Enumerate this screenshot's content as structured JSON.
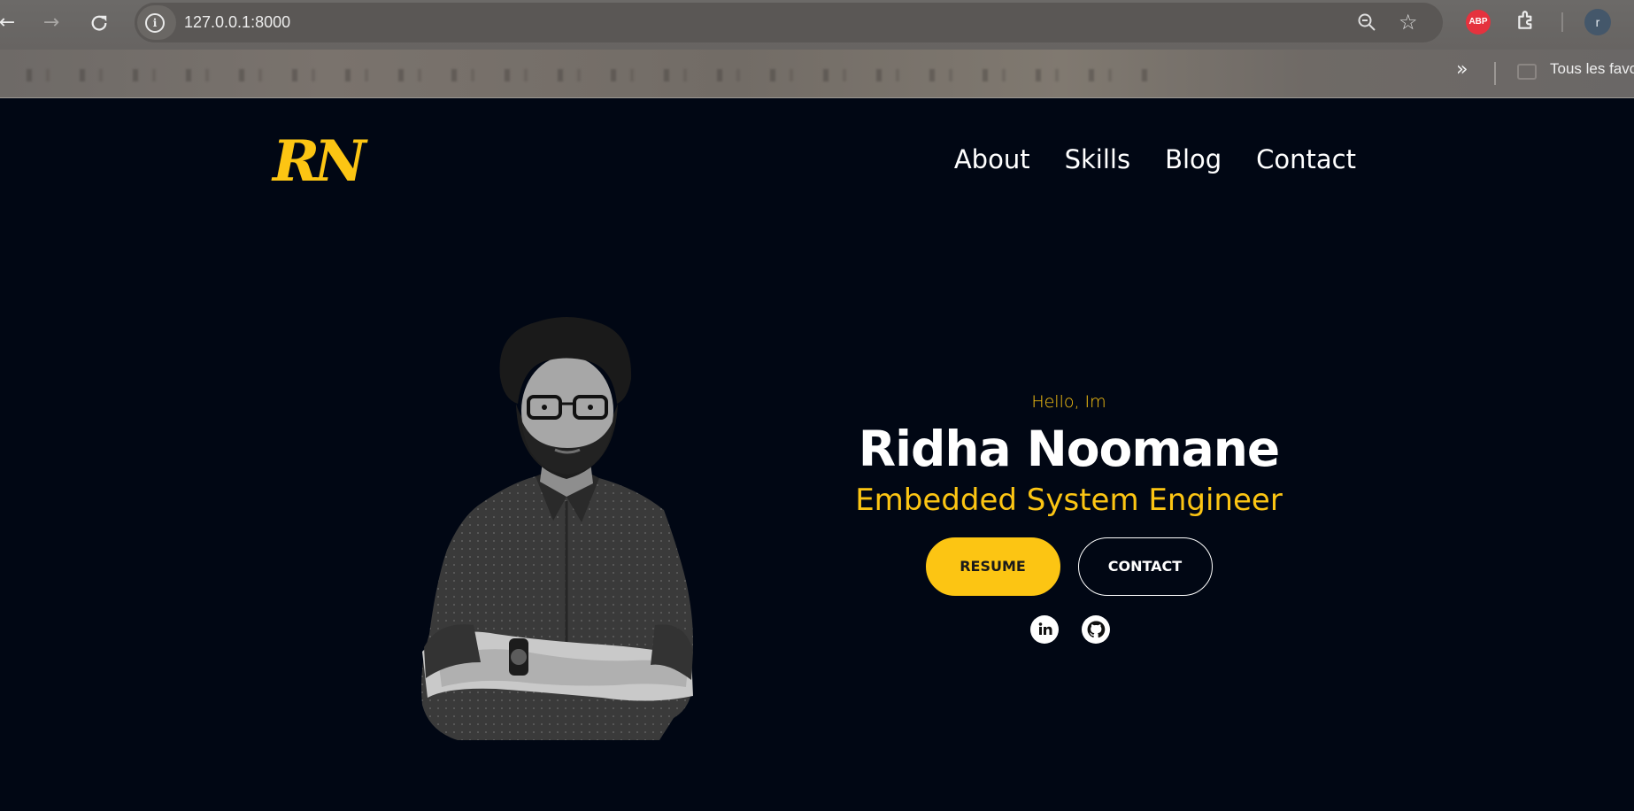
{
  "browser": {
    "url": "127.0.0.1:8000",
    "abp_label": "ABP",
    "profile_initial": "r",
    "bookmarks_folder": "Tous les favoris"
  },
  "site": {
    "logo": "RN",
    "nav": [
      "About",
      "Skills",
      "Blog",
      "Contact"
    ],
    "hero": {
      "greeting": "Hello, Im",
      "name": "Ridha Noomane",
      "role": "Embedded System Engineer",
      "resume_label": "RESUME",
      "contact_label": "CONTACT"
    },
    "socials": [
      "linkedin-icon",
      "github-icon"
    ],
    "colors": {
      "accent": "#fcc513",
      "background": "#010714",
      "text": "#ffffff"
    }
  }
}
